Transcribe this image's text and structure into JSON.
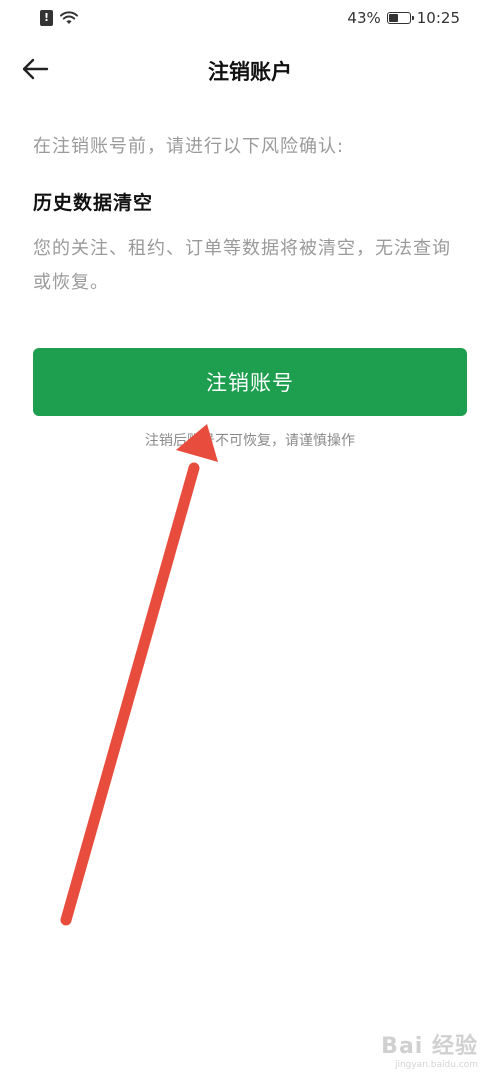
{
  "status_bar": {
    "sim_icon": "sim-alert-icon",
    "wifi_icon": "wifi-icon",
    "battery_percent": "43%",
    "battery_icon": "battery-icon",
    "time": "10:25"
  },
  "nav": {
    "back_icon": "arrow-left-icon",
    "title": "注销账户"
  },
  "main": {
    "hint": "在注销账号前，请进行以下风险确认:",
    "section_title": "历史数据清空",
    "section_desc": "您的关注、租约、订单等数据将被清空，无法查询或恢复。",
    "button_label": "注销账号",
    "warning": "注销后账号不可恢复，请谨慎操作"
  },
  "colors": {
    "accent": "#1e9e4f",
    "annotation_arrow": "#e84c3d"
  },
  "watermark": {
    "logo": "Bai 经验",
    "url": "jingyan.baidu.com"
  }
}
